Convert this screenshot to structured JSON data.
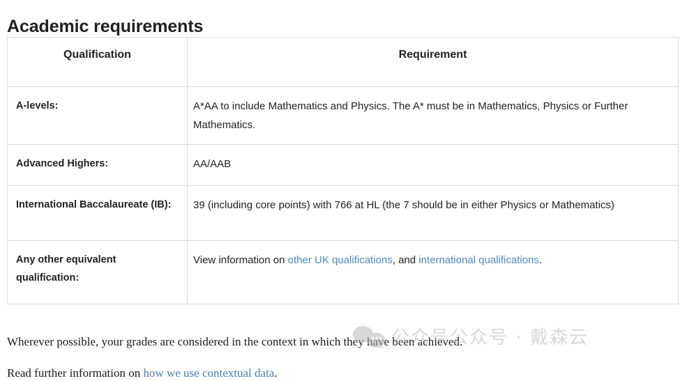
{
  "page": {
    "title": "Academic requirements"
  },
  "table": {
    "headers": {
      "qualification": "Qualification",
      "requirement": "Requirement"
    },
    "rows": [
      {
        "qualification": "A-levels:",
        "requirement": "A*AA to include Mathematics and Physics. The A* must be in Mathematics, Physics or Further Mathematics."
      },
      {
        "qualification": "Advanced Highers:",
        "requirement": "AA/AAB"
      },
      {
        "qualification": "International Baccalaureate (IB):",
        "requirement": "39 (including core points) with 766 at HL (the 7 should be in either Physics or Mathematics)"
      },
      {
        "qualification": "Any other equivalent qualification:",
        "requirement_parts": {
          "lead": " View information on ",
          "link1": "other UK qualifications",
          "middle": ", and ",
          "link2": "international qualifications",
          "tail": "."
        }
      }
    ]
  },
  "notes": {
    "note1": "Wherever possible, your grades are considered in the context in which they have been achieved.",
    "note2_lead": "Read further information on ",
    "note2_link": "how we use contextual data",
    "note2_tail": "."
  },
  "watermark": {
    "text": "公众号公众号 · 戴森云",
    "icon": "wechat-icon",
    "color": "#b9b9b9"
  },
  "colors": {
    "text": "#231f20",
    "body_text": "#222222",
    "link": "#4a89c4",
    "serif_link": "#4a7fb5",
    "border": "#dedbd5",
    "background": "#ffffff"
  }
}
